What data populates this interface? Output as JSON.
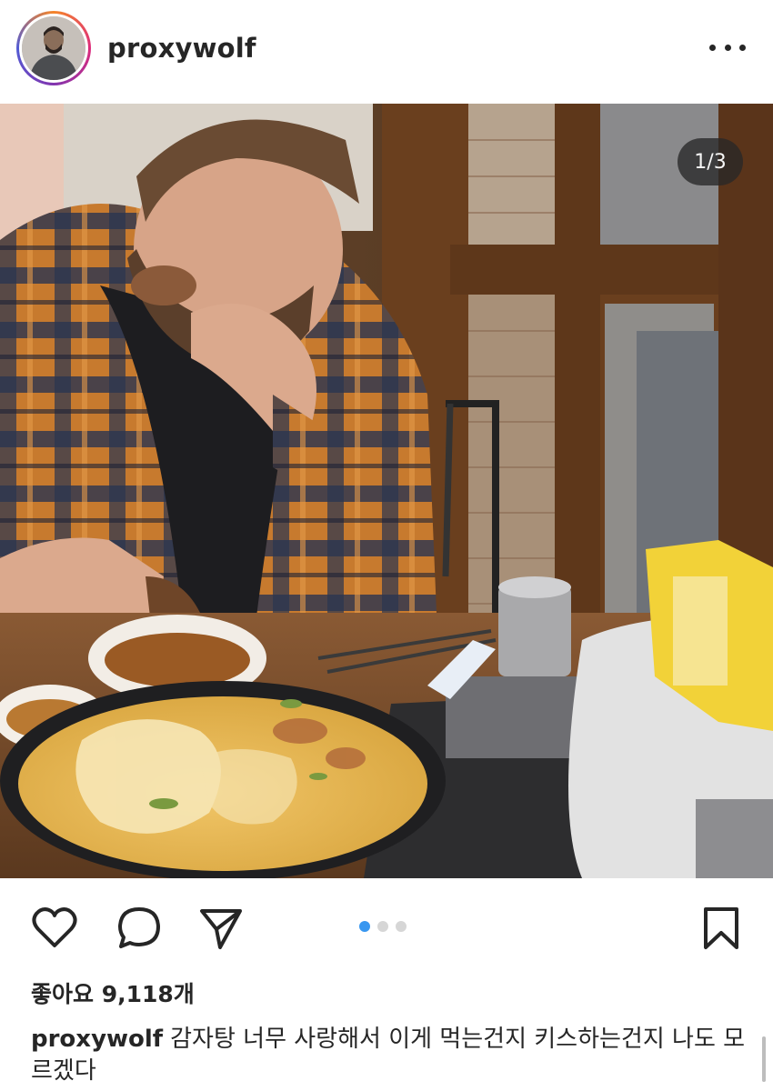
{
  "post": {
    "username": "proxywolf",
    "image_counter": "1/3",
    "likes": "좋아요 9,118개",
    "caption_user": "proxywolf",
    "caption_text": "감자탕 너무 사랑해서 이게 먹는건지 키스하는건지 나도 모르겠다"
  },
  "carousel": {
    "current": 1,
    "total": 3
  },
  "colors": {
    "accent": "#3897f0",
    "text": "#262626"
  },
  "icons": [
    "heart-icon",
    "comment-icon",
    "share-icon",
    "bookmark-icon",
    "more-icon"
  ]
}
